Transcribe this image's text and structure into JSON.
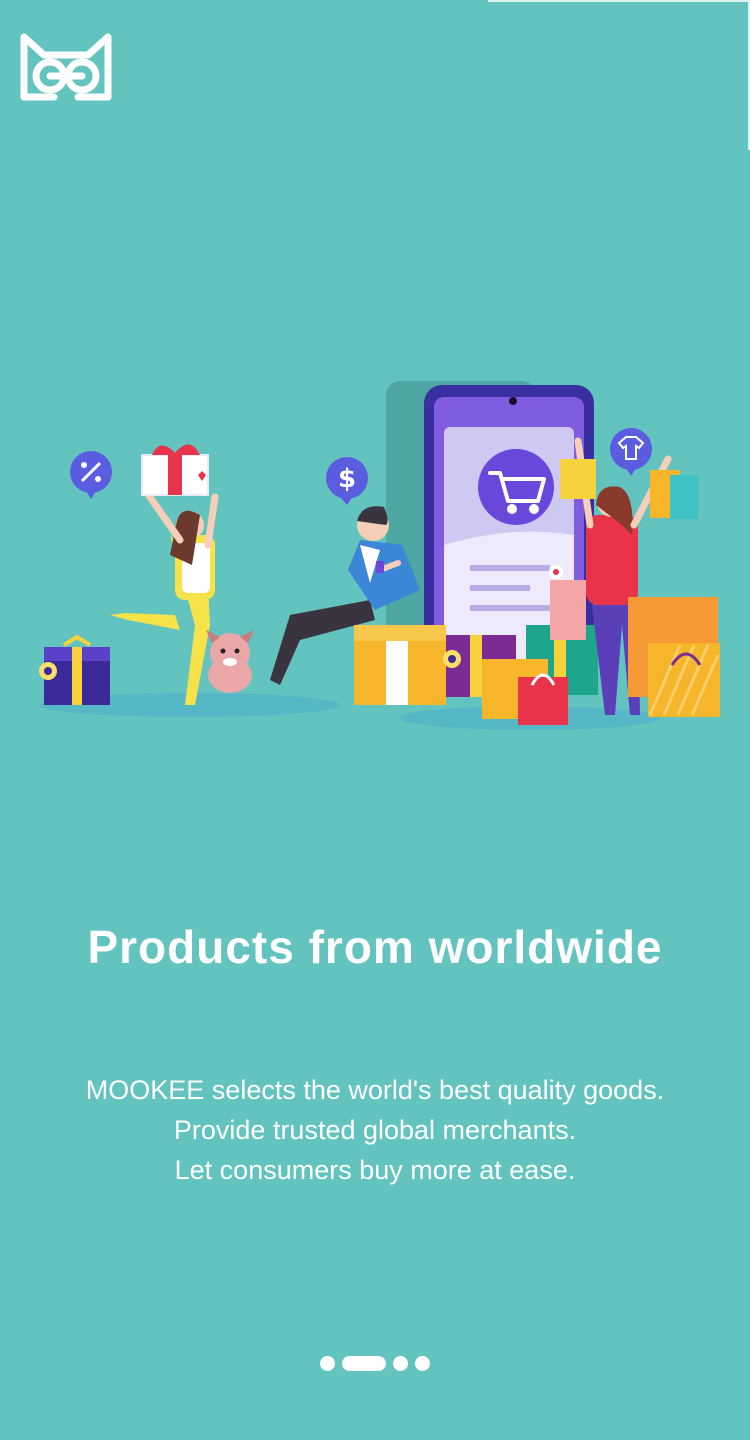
{
  "app": {
    "logo_name": "mookee-logo"
  },
  "onboarding": {
    "headline": "Products from worldwide",
    "description_lines": [
      "MOOKEE selects the world's best quality goods.",
      "Provide trusted global merchants.",
      "Let consumers buy more at ease."
    ],
    "page_indicator": {
      "current": 2,
      "total": 4
    }
  },
  "colors": {
    "background": "#62c3bf",
    "text": "#ffffff",
    "accent_purple": "#6d46d9",
    "accent_red": "#e8334a",
    "accent_yellow": "#f6b52a"
  },
  "icons": [
    "mookee-logo",
    "discount-icon",
    "dollar-icon",
    "shirt-icon",
    "cart-icon"
  ]
}
